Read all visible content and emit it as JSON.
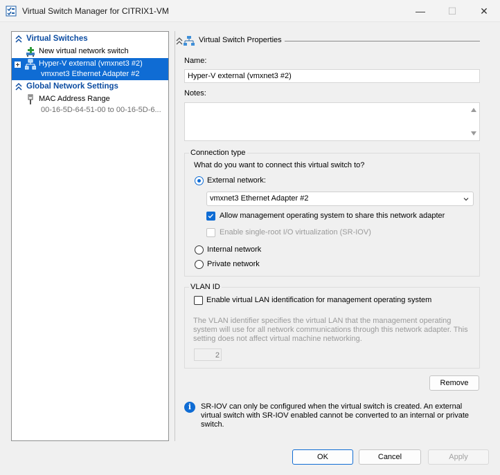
{
  "window": {
    "title": "Virtual Switch Manager for CITRIX1-VM",
    "minimize_glyph": "—",
    "maximize_glyph": "☐",
    "close_glyph": "✕"
  },
  "sidebar": {
    "virtual_switches_header": "Virtual Switches",
    "new_switch_label": "New virtual network switch",
    "switch_item": {
      "name": "Hyper-V external (vmxnet3 #2)",
      "adapter": "vmxnet3 Ethernet Adapter #2"
    },
    "global_header": "Global Network Settings",
    "mac_item": {
      "label": "MAC Address Range",
      "value": "00-16-5D-64-51-00 to 00-16-5D-6..."
    }
  },
  "properties": {
    "header": "Virtual Switch Properties",
    "name_label": "Name:",
    "name_value": "Hyper-V external (vmxnet3 #2)",
    "notes_label": "Notes:",
    "notes_value": "",
    "connection_type": {
      "title": "Connection type",
      "question": "What do you want to connect this virtual switch to?",
      "external_label": "External network:",
      "adapter_selected": "vmxnet3 Ethernet Adapter #2",
      "allow_mgmt_label": "Allow management operating system to share this network adapter",
      "sriov_label": "Enable single-root I/O virtualization (SR-IOV)",
      "internal_label": "Internal network",
      "private_label": "Private network"
    },
    "vlan": {
      "title": "VLAN ID",
      "enable_label": "Enable virtual LAN identification for management operating system",
      "description": "The VLAN identifier specifies the virtual LAN that the management operating system will use for all network communications through this network adapter. This setting does not affect virtual machine networking.",
      "value": "2"
    },
    "remove_label": "Remove",
    "info_text": "SR-IOV can only be configured when the virtual switch is created. An external virtual switch with SR-IOV enabled cannot be converted to an internal or private switch."
  },
  "footer": {
    "ok_label": "OK",
    "cancel_label": "Cancel",
    "apply_label": "Apply"
  },
  "colors": {
    "accent": "#0f6cd4",
    "header_text": "#0c4ca1"
  }
}
